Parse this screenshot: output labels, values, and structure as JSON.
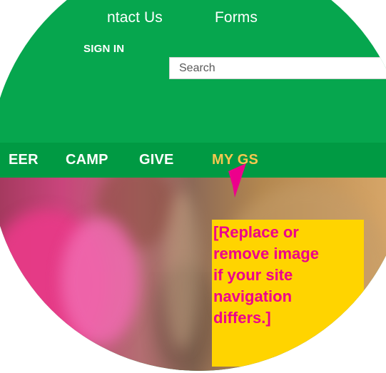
{
  "top_links": {
    "contact": "ntact Us",
    "forms": "Forms"
  },
  "account": {
    "sign_in": "SIGN IN"
  },
  "search": {
    "placeholder": "Search"
  },
  "nav": {
    "items": [
      {
        "label": "EER"
      },
      {
        "label": "CAMP"
      },
      {
        "label": "GIVE"
      },
      {
        "label": "MY GS"
      }
    ]
  },
  "callout": {
    "text": "[Replace or\nremove image\nif your site\nnavigation\ndiffers.]"
  },
  "icons": {
    "pointer": "arrow-pointer-icon"
  },
  "colors": {
    "header_green": "#06a64e",
    "nav_green": "#009a43",
    "active_nav": "#f6c74f",
    "callout_bg": "#ffd400",
    "callout_text": "#ed008c",
    "pointer": "#ed008c"
  }
}
